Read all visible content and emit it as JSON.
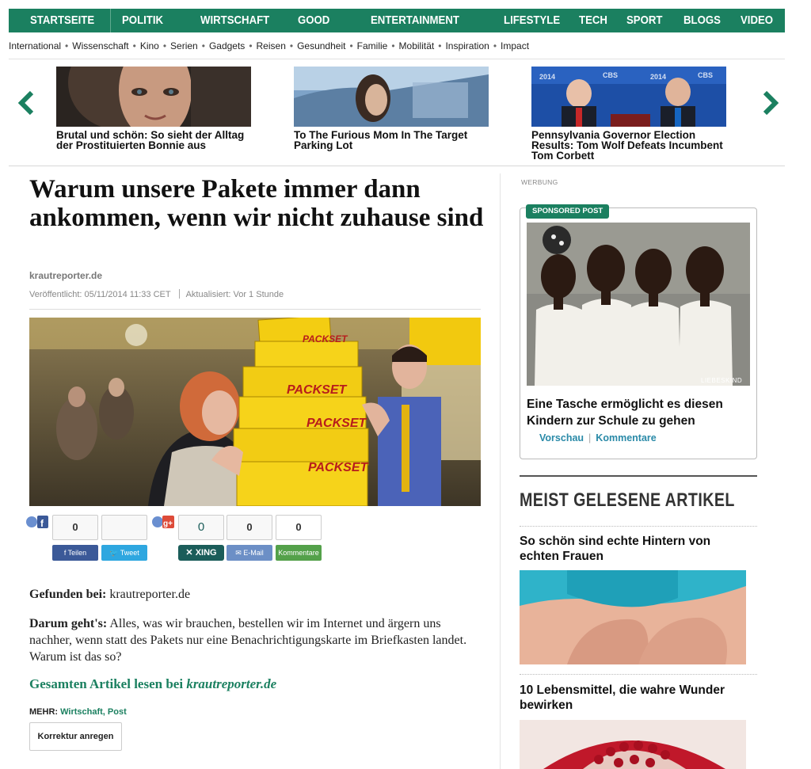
{
  "nav": {
    "main": [
      "STARTSEITE",
      "POLITIK",
      "WIRTSCHAFT",
      "GOOD",
      "ENTERTAINMENT",
      "LIFESTYLE",
      "TECH",
      "SPORT",
      "BLOGS",
      "VIDEO"
    ],
    "sub": [
      "International",
      "Wissenschaft",
      "Kino",
      "Serien",
      "Gadgets",
      "Reisen",
      "Gesundheit",
      "Familie",
      "Mobilität",
      "Inspiration",
      "Impact"
    ]
  },
  "carousel": {
    "items": [
      {
        "caption": "Brutal und schön: So sieht der Alltag der Prostituierten Bonnie aus"
      },
      {
        "caption": "To The Furious Mom In The Target Parking Lot"
      },
      {
        "caption": "Pennsylvania Governor Election Results: Tom Wolf Defeats Incumbent Tom Corbett"
      }
    ]
  },
  "article": {
    "headline": "Warum unsere Pakete immer dann ankommen, wenn wir nicht zuhause sind",
    "source": "krautreporter.de",
    "published": "Veröffentlicht: 05/11/2014 11:33 CET",
    "updated": "Aktualisiert: Vor 1 Stunde",
    "image_labels": [
      "PACKSET",
      "PACKSET",
      "PACKSET",
      "PACKSET"
    ],
    "found_label": "Gefunden bei:",
    "found_value": " krautreporter.de",
    "about_label": "Darum geht's:",
    "about_text": " Alles, was wir brauchen, bestellen wir im Internet und ärgern uns nachher, wenn statt des Pakets nur eine Benachrichtigungskarte im Briefkasten landet. Warum ist das so?",
    "readmore_prefix": "Gesamten Artikel lesen bei ",
    "readmore_link": "krautreporter.de",
    "more_label": "MEHR:",
    "more_tags": "Wirtschaft, Post",
    "korrektur": "Korrektur anregen"
  },
  "share": {
    "facebook": {
      "count": "0",
      "label": "Teilen",
      "color": "#3b5998"
    },
    "twitter": {
      "count": "",
      "label": "Tweet",
      "color": "#2ea7e0"
    },
    "xing": {
      "count": "0",
      "label": "XING",
      "color": "#1b5d5a"
    },
    "email": {
      "count": "0",
      "label": "E-Mail",
      "color": "#6c8fc6"
    },
    "comments": {
      "count": "0",
      "label": "Kommentare",
      "color": "#54a14a"
    }
  },
  "sidebar": {
    "ad_label": "WERBUNG",
    "sponsored_badge": "SPONSORED POST",
    "sponsored_img_credit": "LIEBESKIND",
    "sponsored_title": "Eine Tasche ermöglicht es diesen Kindern zur Schule zu gehen",
    "preview_link": "Vorschau",
    "comments_link": "Kommentare",
    "most_read_title": "MEIST GELESENE ARTIKEL",
    "popular": [
      {
        "title": "So schön sind echte Hintern von echten Frauen"
      },
      {
        "title": "10 Lebensmittel, die wahre Wunder bewirken"
      }
    ]
  },
  "colors": {
    "brand": "#1b8060",
    "link": "#2a8aa8"
  }
}
